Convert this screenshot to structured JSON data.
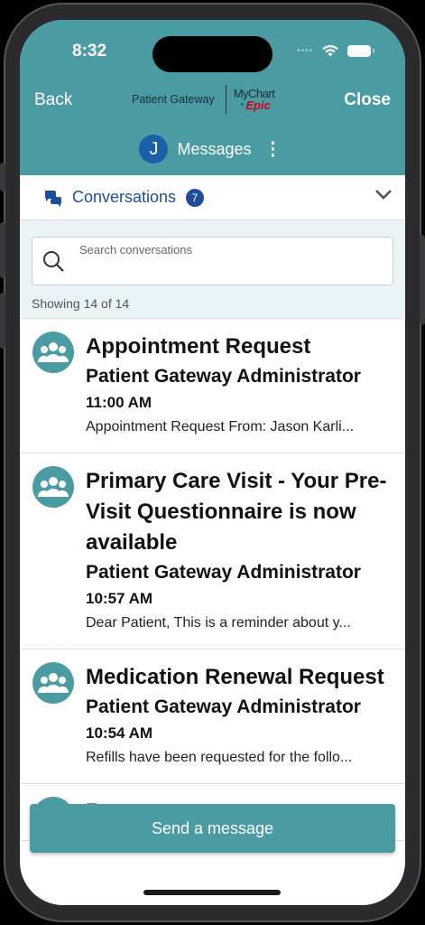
{
  "status_bar": {
    "time": "8:32"
  },
  "nav": {
    "back_label": "Back",
    "close_label": "Close",
    "brand_name": "Patient Gateway",
    "brand_mychart": "MyChart",
    "brand_is": "is",
    "brand_epic": "Epic"
  },
  "header": {
    "avatar_initial": "J",
    "title": "Messages"
  },
  "conversations": {
    "label": "Conversations",
    "count": "7"
  },
  "search": {
    "placeholder": "Search conversations",
    "showing": "Showing 14 of 14"
  },
  "messages": [
    {
      "title": "Appointment Request",
      "sender": "Patient Gateway Administrator",
      "time": "11:00 AM",
      "preview": "Appointment Request From: Jason Karli..."
    },
    {
      "title": "Primary Care Visit - Your Pre-Visit Questionnaire is now available",
      "sender": "Patient Gateway Administrator",
      "time": "10:57 AM",
      "preview": "Dear Patient, This is a reminder about y..."
    },
    {
      "title": "Medication Renewal Request",
      "sender": "Patient Gateway Administrator",
      "time": "10:54 AM",
      "preview": "Refills have been requested for the follo..."
    },
    {
      "title": "Request",
      "sender": "",
      "time": "",
      "preview": ""
    }
  ],
  "send_button_label": "Send a message",
  "colors": {
    "teal": "#4b9ba3",
    "navy": "#1f4d9b",
    "unread": "#1f5fc4",
    "epic_red": "#d0021b"
  },
  "icons": [
    "wifi-icon",
    "battery-icon",
    "chat-bubbles-icon",
    "chevron-down-icon",
    "search-icon",
    "group-icon"
  ]
}
